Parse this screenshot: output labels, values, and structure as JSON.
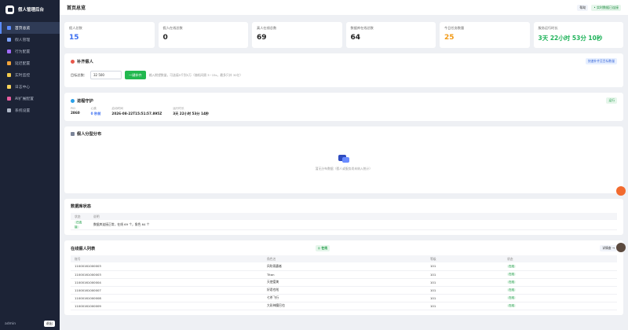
{
  "app": {
    "title": "假人管理后台",
    "user": "admin",
    "logout": "退出"
  },
  "nav": [
    {
      "label": "首页总览",
      "icon": "home-icon",
      "color": "#5b8cff",
      "active": true
    },
    {
      "label": "假人管理",
      "icon": "user-icon",
      "color": "#7da2ff"
    },
    {
      "label": "行为配置",
      "icon": "sliders-icon",
      "color": "#a16bff"
    },
    {
      "label": "延迟配置",
      "icon": "clock-icon",
      "color": "#f2a33a"
    },
    {
      "label": "实时监控",
      "icon": "pulse-icon",
      "color": "#f2c94c"
    },
    {
      "label": "日志中心",
      "icon": "file-icon",
      "color": "#f7d35a"
    },
    {
      "label": "AI扩展配置",
      "icon": "brain-icon",
      "color": "#e85d9f"
    },
    {
      "label": "系统设置",
      "icon": "gear-icon",
      "color": "#aeb6c6"
    }
  ],
  "header": {
    "title": "首页总览",
    "help": "帮助",
    "live": "• 实时数据已连接"
  },
  "stats": [
    {
      "label": "假人总数",
      "value": "15",
      "color": "#3a6df0"
    },
    {
      "label": "假人在线总数",
      "value": "0",
      "color": "#222222"
    },
    {
      "label": "真人在线总数",
      "value": "69",
      "color": "#222222"
    },
    {
      "label": "数据库在线总数",
      "value": "64",
      "color": "#222222"
    },
    {
      "label": "今日任务数量",
      "value": "25",
      "color": "#f29a16"
    },
    {
      "label": "服务运行时长",
      "value": "3天 22小时 53分 10秒",
      "color": "#1fb35a"
    }
  ],
  "refill": {
    "title": "补齐假人",
    "tag": "快速补齐至目标数量",
    "label": "目标总数：",
    "value": "32 500",
    "button": "一键补齐",
    "hint": "输入期望数量，可选填5千到5万（随机间隔 3~15s，最多只补 30亿）"
  },
  "guard": {
    "title": "进程守护",
    "status": "运行",
    "fields": [
      {
        "k": "PID",
        "v": "2860"
      },
      {
        "k": "心跳",
        "v": "0 秒前"
      },
      {
        "k": "启动时间",
        "v": "2026-08-22T15:51:57.895Z"
      },
      {
        "k": "运行时长",
        "v": "3天 22小时 53分 14秒"
      }
    ]
  },
  "distribution": {
    "title": "假人分型分布",
    "empty": "暂无分布数据（假人或服务尚未纳入统计）"
  },
  "db": {
    "title": "数据库状态",
    "headers": [
      "状态",
      "说明"
    ],
    "rows": [
      {
        "status": "已连接",
        "desc": "数据库连接正常，在线 69 个，角色 64 个"
      }
    ]
  },
  "online": {
    "title": "在线假人列表",
    "tag": "◎ 在线",
    "query": "详情查 →",
    "headers": [
      "账号",
      "角色名",
      "等级",
      "状态"
    ],
    "rows": [
      {
        "account": "11000161000003",
        "name": "风吹雨露者",
        "level": "101",
        "status": "在线"
      },
      {
        "account": "11000161000003",
        "name": "Titan",
        "level": "101",
        "status": "在线"
      },
      {
        "account": "11000161000004",
        "name": "天使爱美",
        "level": "101",
        "status": "在线"
      },
      {
        "account": "11000161000007",
        "name": "好君也啦",
        "level": "101",
        "status": "在线"
      },
      {
        "account": "11000161000008",
        "name": "七杀飞行",
        "level": "101",
        "status": "在线"
      },
      {
        "account": "11000161000009",
        "name": "大彩神魔召也",
        "level": "101",
        "status": "在线"
      }
    ]
  }
}
